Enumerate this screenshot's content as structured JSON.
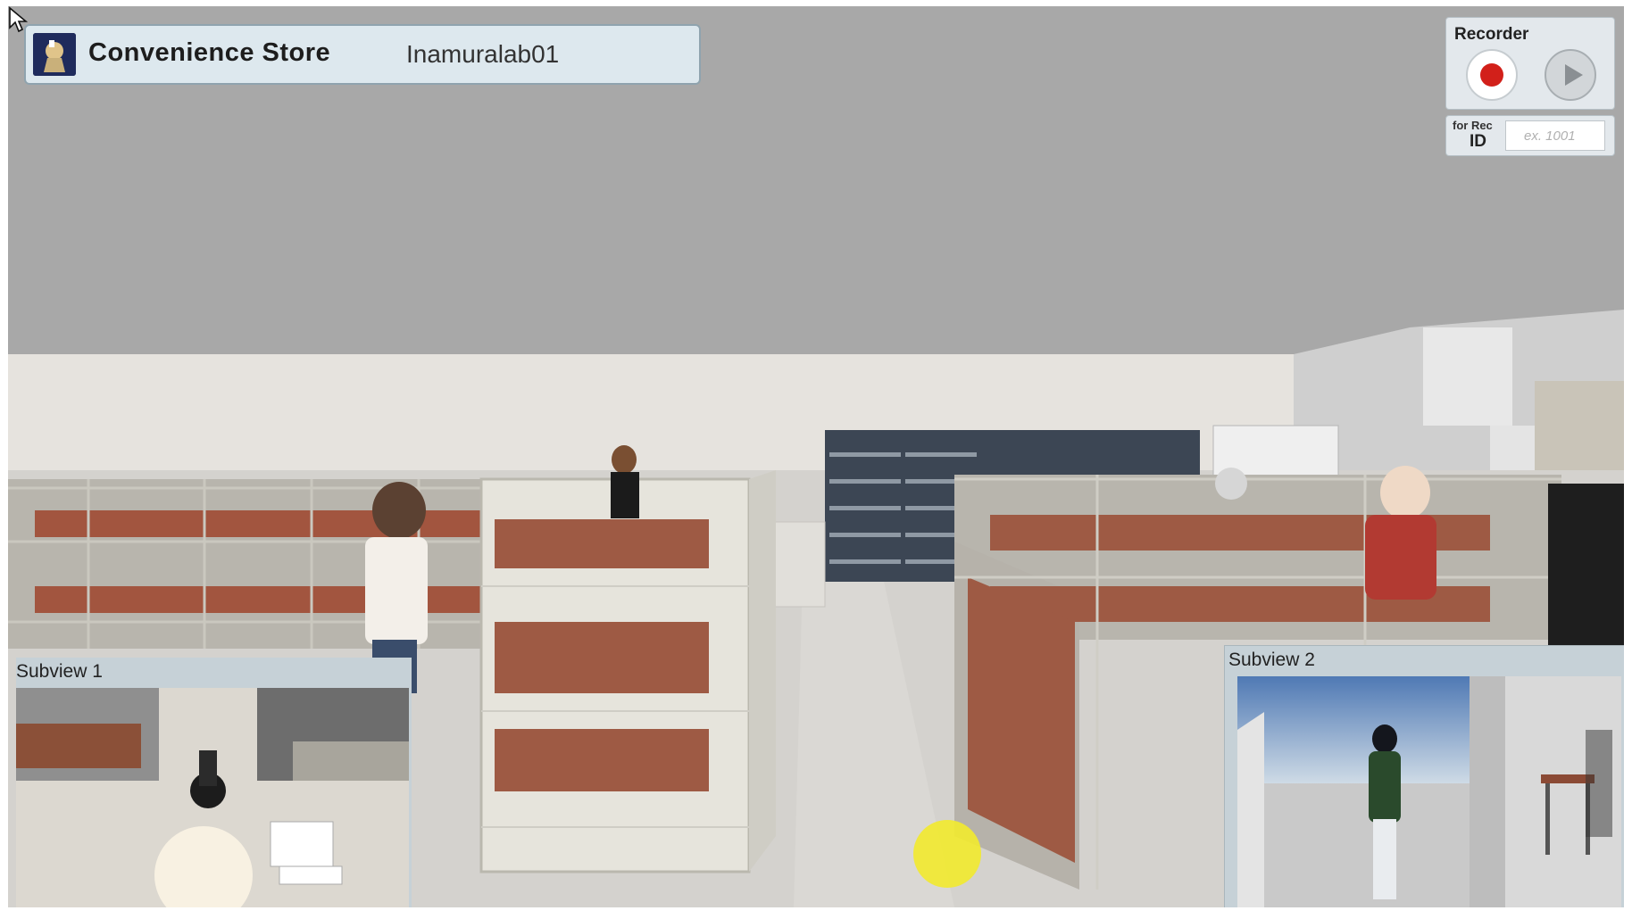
{
  "header": {
    "app_title": "Convenience Store",
    "user_name": "Inamuralab01"
  },
  "recorder": {
    "title": "Recorder",
    "record_icon": "record-icon",
    "play_icon": "play-icon",
    "for_rec_label": "for Rec",
    "id_label": "ID",
    "id_placeholder": "ex. 1001",
    "record_color": "#d2201a"
  },
  "subviews": [
    {
      "title": "Subview 1"
    },
    {
      "title": "Subview 2"
    }
  ],
  "cursor": {
    "icon": "mouse-pointer-icon",
    "highlight_color": "#f2ea2e"
  }
}
